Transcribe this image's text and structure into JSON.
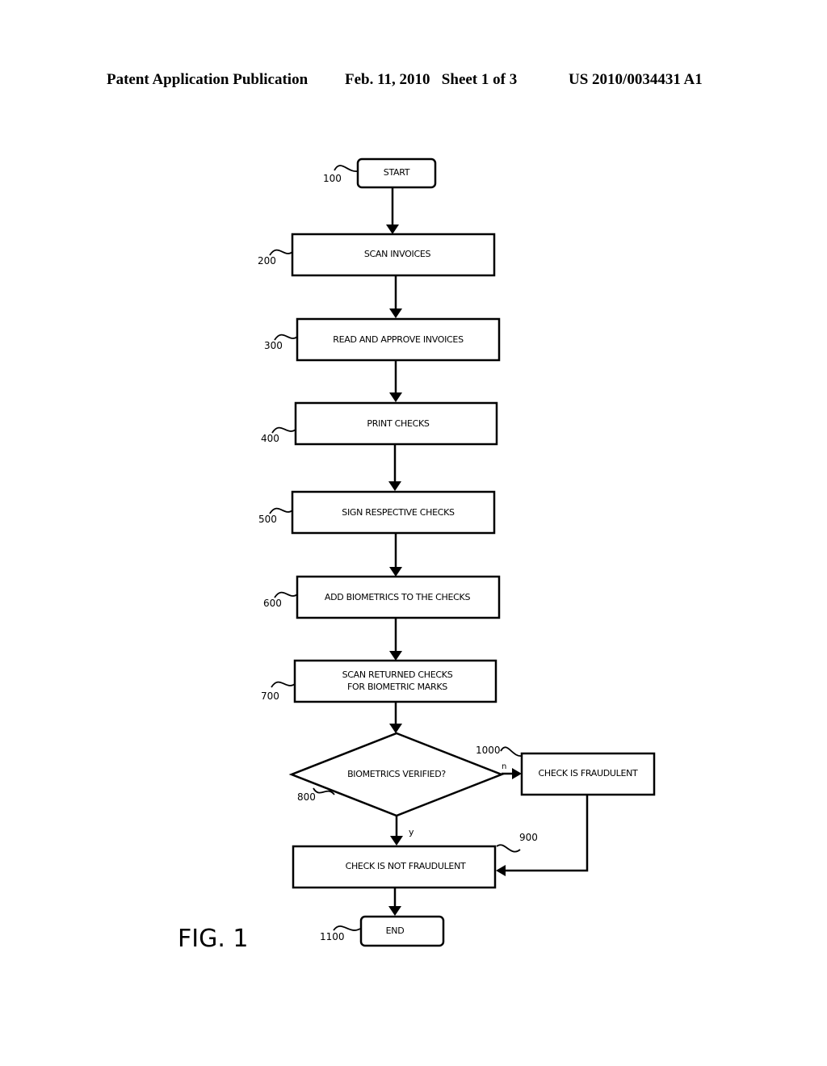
{
  "header": {
    "publication": "Patent Application Publication",
    "date_sheet": "Feb. 11, 2010   Sheet 1 of 3",
    "number": "US 2010/0034431 A1"
  },
  "figure_label": "FIG. 1",
  "steps": {
    "start": {
      "ref": "100",
      "label": "START"
    },
    "scan_invoices": {
      "ref": "200",
      "label": "SCAN INVOICES"
    },
    "read_approve": {
      "ref": "300",
      "label": "READ AND APPROVE INVOICES"
    },
    "print_checks": {
      "ref": "400",
      "label": "PRINT CHECKS"
    },
    "sign_checks": {
      "ref": "500",
      "label": "SIGN RESPECTIVE CHECKS"
    },
    "add_biometrics": {
      "ref": "600",
      "label": "ADD BIOMETRICS TO THE CHECKS"
    },
    "scan_returned": {
      "ref": "700",
      "label_line1": "SCAN RETURNED CHECKS",
      "label_line2": "FOR BIOMETRIC MARKS"
    },
    "decision": {
      "ref": "800",
      "label": "BIOMETRICS VERIFIED?",
      "yes_label": "y",
      "no_label": "n"
    },
    "not_fraudulent": {
      "ref": "900",
      "label": "CHECK IS NOT FRAUDULENT"
    },
    "fraudulent": {
      "ref": "1000",
      "label": "CHECK IS FRAUDULENT"
    },
    "end": {
      "ref": "1100",
      "label": "END"
    }
  }
}
